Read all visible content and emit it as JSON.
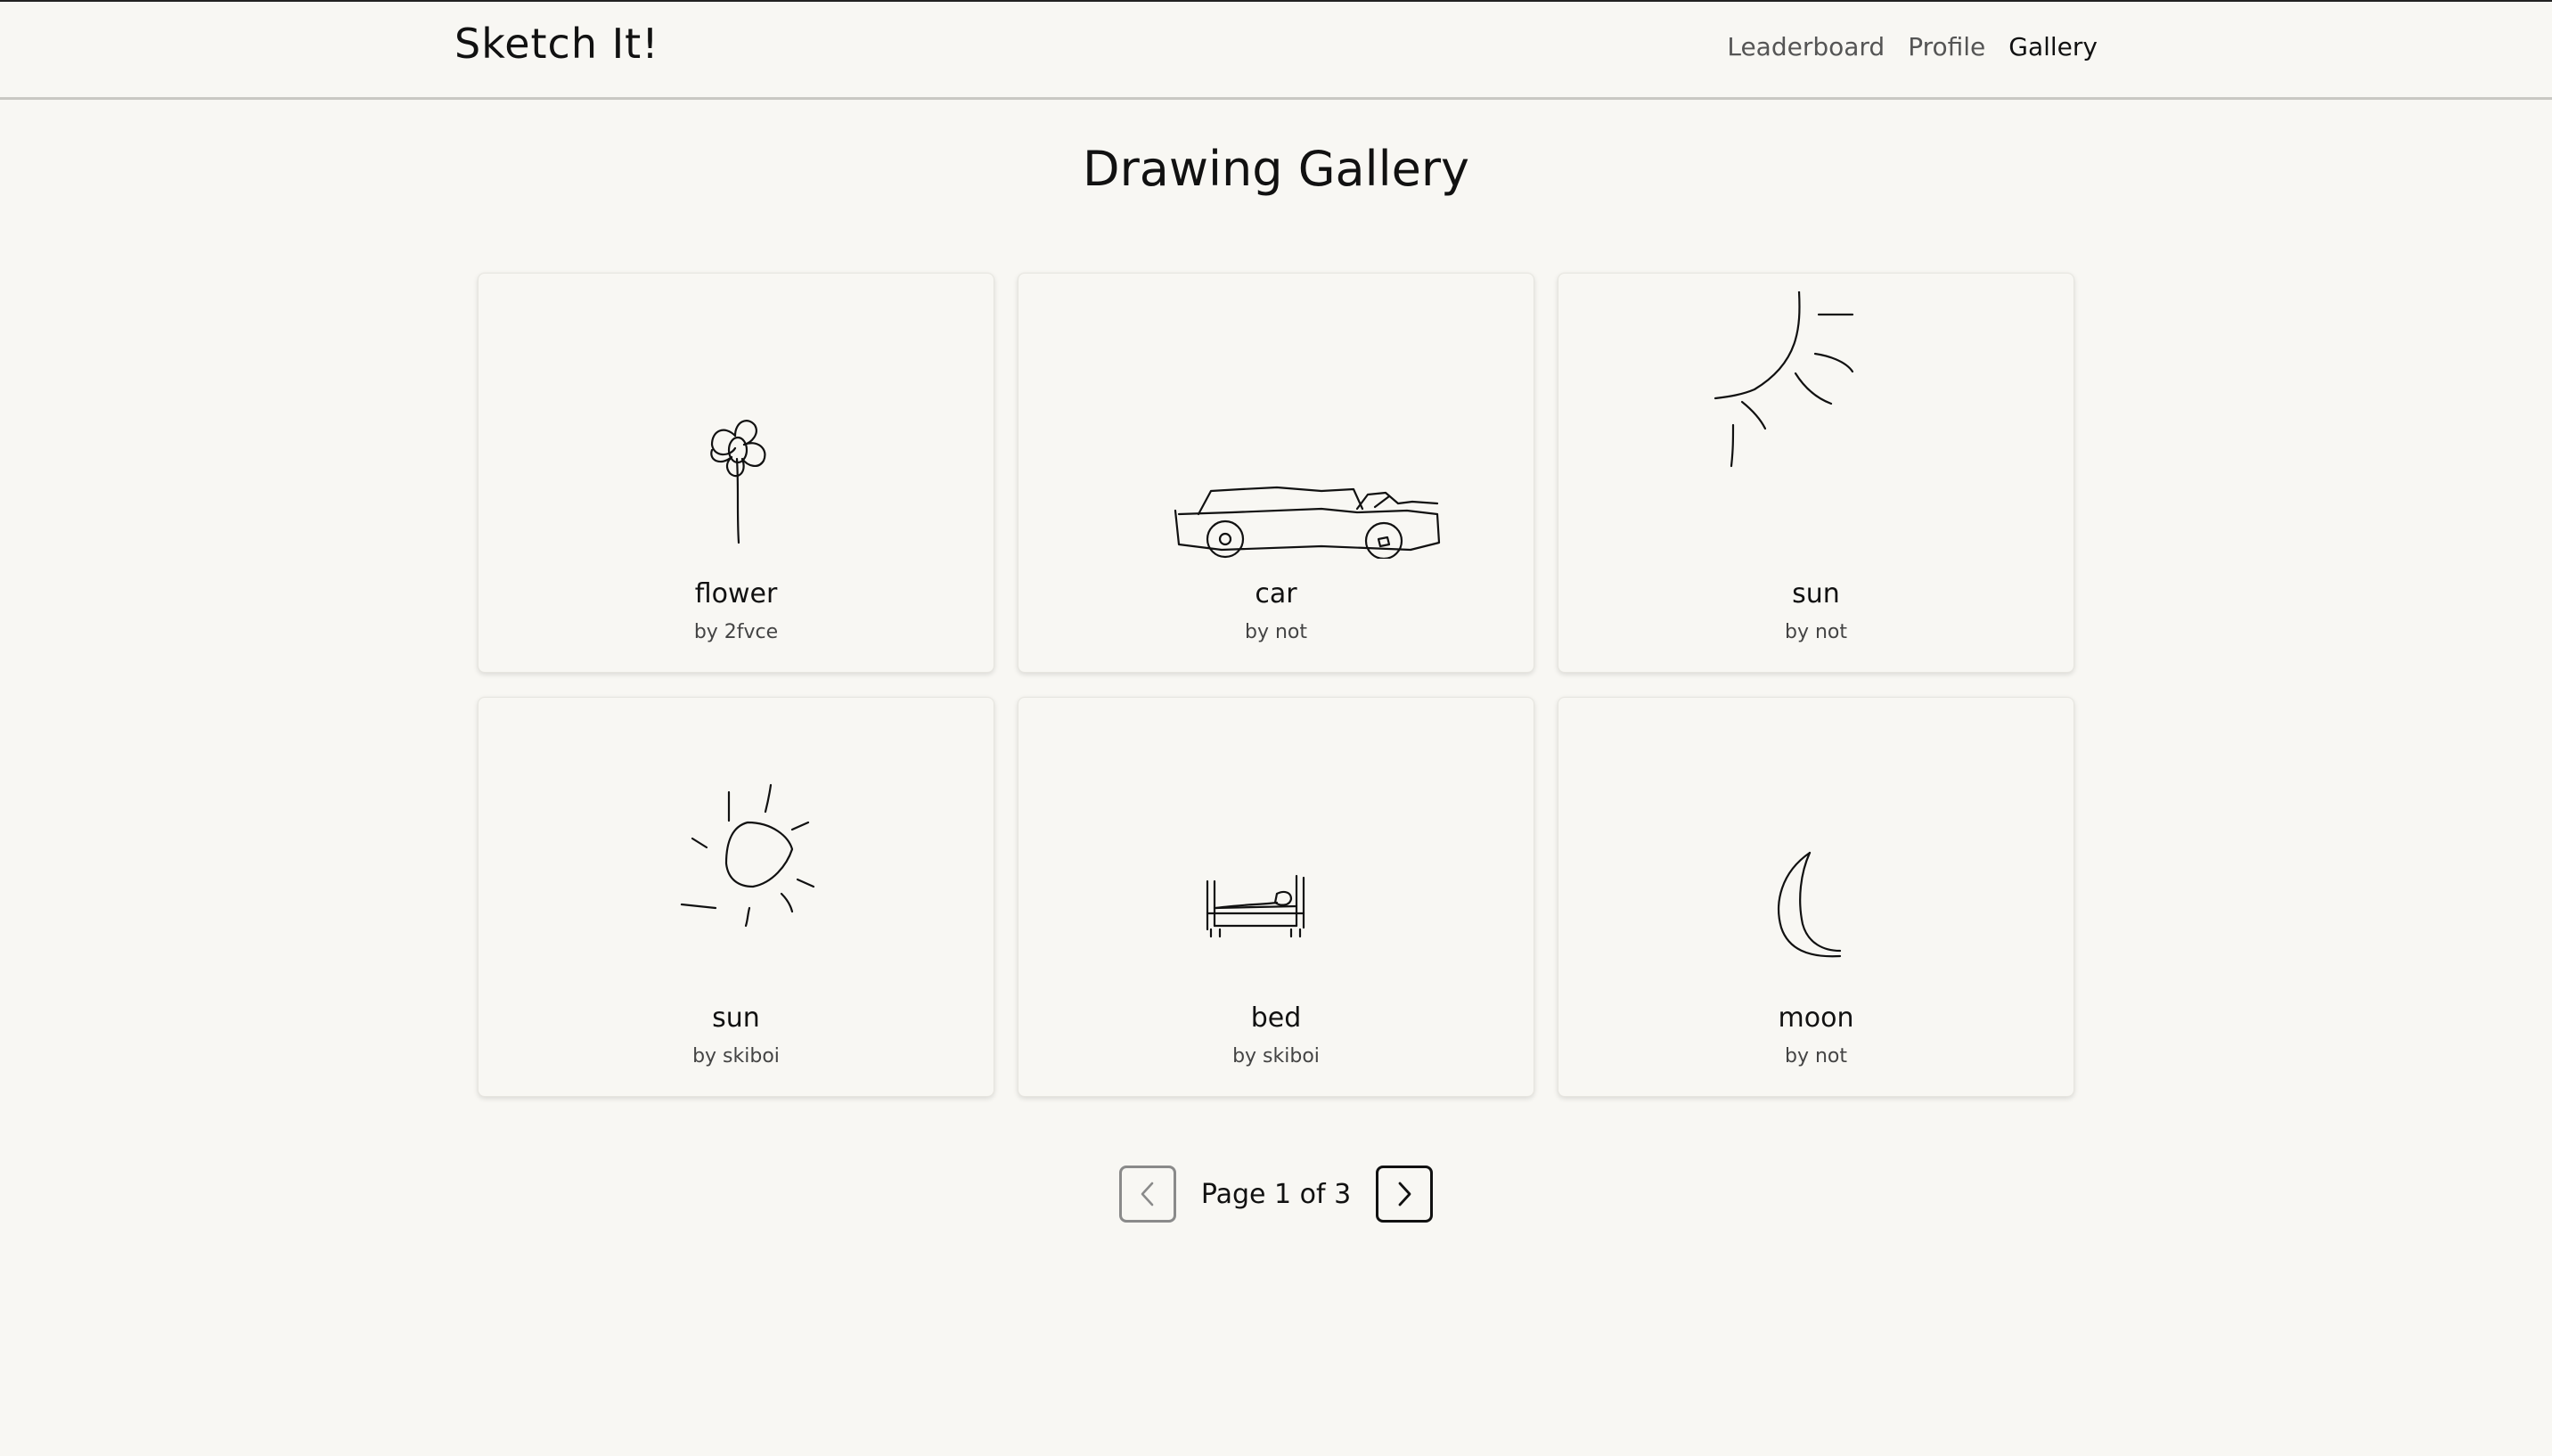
{
  "header": {
    "brand": "Sketch It!",
    "nav": [
      {
        "label": "Leaderboard",
        "active": false
      },
      {
        "label": "Profile",
        "active": false
      },
      {
        "label": "Gallery",
        "active": true
      }
    ]
  },
  "main": {
    "title": "Drawing Gallery",
    "cards": [
      {
        "word": "flower",
        "author": "by 2fvce",
        "icon": "flower-drawing"
      },
      {
        "word": "car",
        "author": "by not",
        "icon": "car-drawing"
      },
      {
        "word": "sun",
        "author": "by not",
        "icon": "sun-drawing"
      },
      {
        "word": "sun",
        "author": "by skiboi",
        "icon": "sun-drawing"
      },
      {
        "word": "bed",
        "author": "by skiboi",
        "icon": "bed-drawing"
      },
      {
        "word": "moon",
        "author": "by not",
        "icon": "moon-drawing"
      }
    ]
  },
  "pagination": {
    "text": "Page 1 of 3",
    "prev_icon": "chevron-left-icon",
    "next_icon": "chevron-right-icon"
  }
}
